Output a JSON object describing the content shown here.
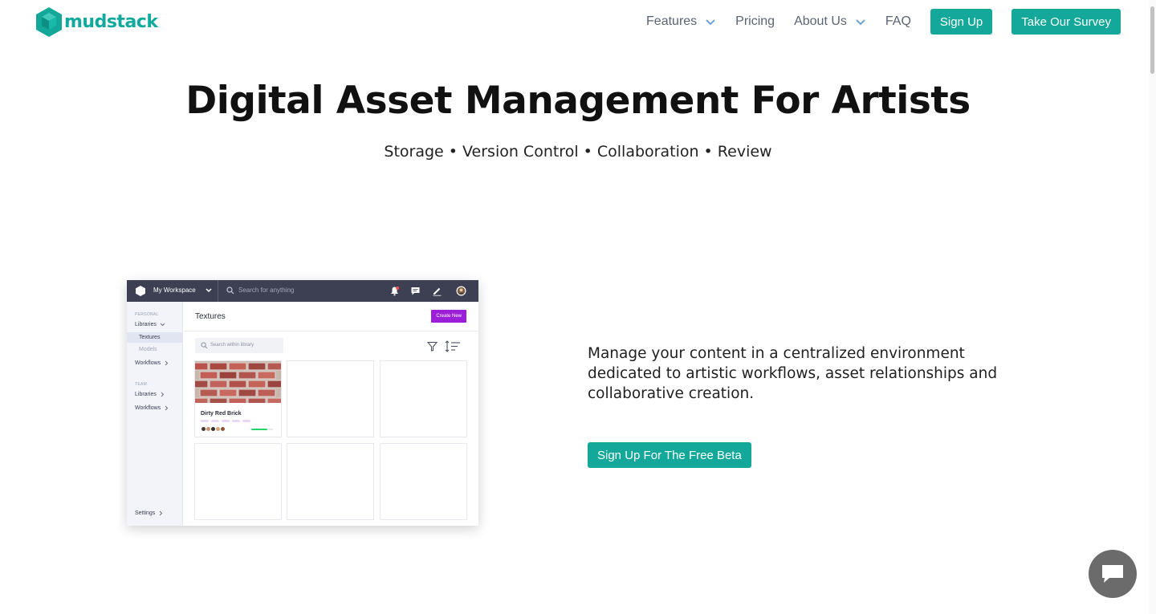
{
  "brand": {
    "name": "mudstack",
    "color": "#13a89a"
  },
  "nav": {
    "features": "Features",
    "pricing": "Pricing",
    "about": "About Us",
    "faq": "FAQ",
    "signup": "Sign Up",
    "survey": "Take Our Survey"
  },
  "hero": {
    "title": "Digital Asset Management For Artists",
    "subtitle": "Storage • Version Control • Collaboration • Review"
  },
  "mockup": {
    "workspace": "My Workspace",
    "search_placeholder": "Search for anything",
    "sidebar": {
      "personal_label": "PERSONAL",
      "libraries": "Libraries",
      "textures": "Textures",
      "models": "Models",
      "workflows": "Workflows",
      "team_label": "TEAM",
      "team_libraries": "Libraries",
      "team_workflows": "Workflows",
      "settings": "Settings"
    },
    "page_title": "Textures",
    "create_button": "Create New",
    "library_search_placeholder": "Search within library",
    "card": {
      "name": "Dirty Red Brick",
      "progress": 0.75
    }
  },
  "content": {
    "description": "Manage your content in a centralized environment dedicated to artistic workflows, asset relationships and collaborative creation.",
    "cta": "Sign Up For The Free Beta"
  },
  "icons": {
    "logo": "hexagon-cube-icon",
    "chat": "chat-bubble-icon"
  }
}
